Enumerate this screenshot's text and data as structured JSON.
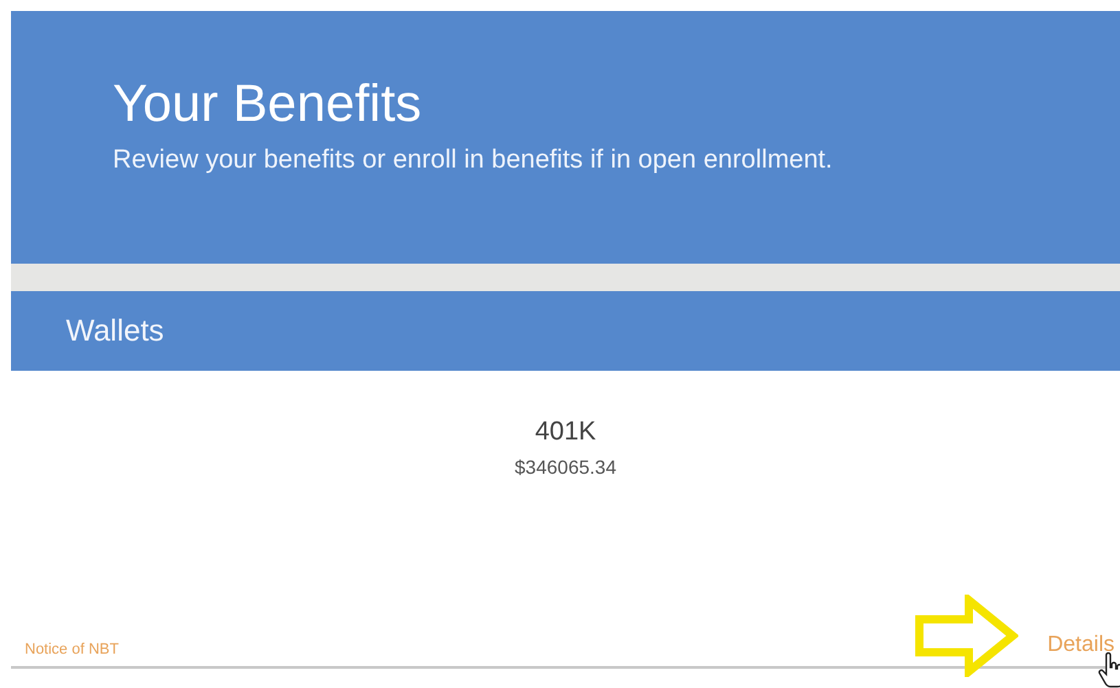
{
  "header": {
    "title": "Your Benefits",
    "subtitle": "Review your benefits or enroll in benefits if in open enrollment."
  },
  "section": {
    "title": "Wallets"
  },
  "wallets": [
    {
      "name": "401K",
      "amount": "$346065.34"
    }
  ],
  "footer": {
    "notice_link": "Notice of NBT",
    "details_link": "Details"
  }
}
